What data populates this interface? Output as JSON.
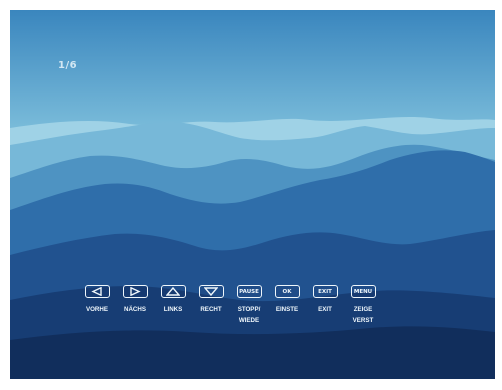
{
  "slideshow": {
    "counter": "1/6"
  },
  "controls": [
    {
      "name": "previous-button",
      "icon": "arrow-left-icon",
      "button_text": "",
      "label": "VORHE"
    },
    {
      "name": "next-button",
      "icon": "arrow-right-icon",
      "button_text": "",
      "label": "NÄCHS"
    },
    {
      "name": "rotate-left-button",
      "icon": "arrow-up-icon",
      "button_text": "",
      "label": "LINKS"
    },
    {
      "name": "rotate-right-button",
      "icon": "arrow-down-icon",
      "button_text": "",
      "label": "RECHT"
    },
    {
      "name": "pause-button",
      "icon": "",
      "button_text": "PAUSE",
      "label": "STOPP/\nWIEDE"
    },
    {
      "name": "ok-button",
      "icon": "",
      "button_text": "OK",
      "label": "EINSTE"
    },
    {
      "name": "exit-button",
      "icon": "",
      "button_text": "EXIT",
      "label": "EXIT"
    },
    {
      "name": "menu-button",
      "icon": "",
      "button_text": "MENU",
      "label": "ZEIGE\nVERST"
    }
  ],
  "colors": {
    "sky_top": "#3a88c0",
    "sky_bottom": "#b8e0ee",
    "control_fg": "#eef6fb"
  }
}
